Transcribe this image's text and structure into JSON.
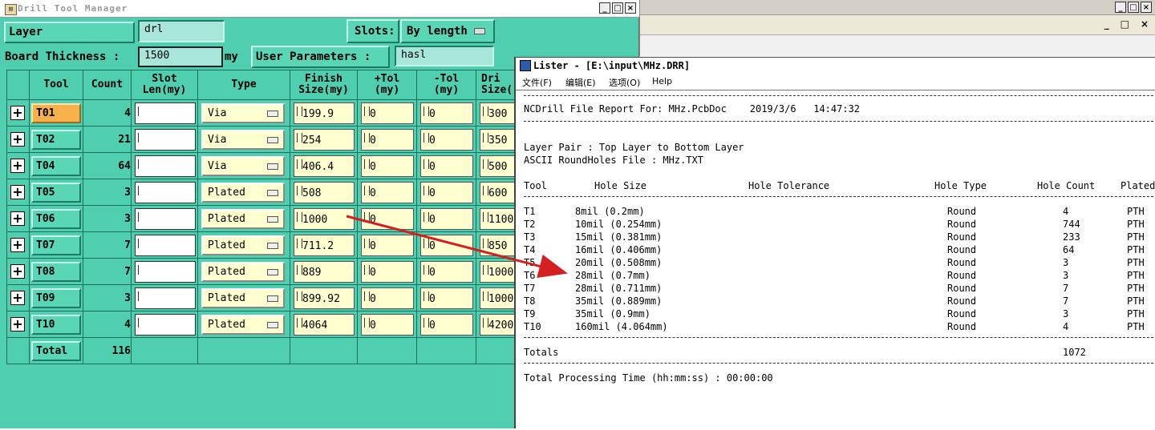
{
  "drill": {
    "title": "Drill Tool Manager",
    "window_buttons": [
      "_",
      "□",
      "×"
    ],
    "layer_label": "Layer                :",
    "layer_value": "drl",
    "slots_label": "Slots:",
    "slots_value": "By length",
    "thickness_label": "Board Thickness :",
    "thickness_value": "1500",
    "thickness_unit": "my",
    "user_params_label": "User Parameters :",
    "user_params_value": "hasl",
    "headers": {
      "tool": "Tool",
      "count": "Count",
      "slot1": "Slot",
      "slot2": "Len(my)",
      "type": "Type",
      "finish1": "Finish",
      "finish2": "Size(my)",
      "ptol1": "+Tol",
      "ptol2": "(my)",
      "mtol1": "-Tol",
      "mtol2": "(my)",
      "drill1": "Dri",
      "drill2": "Size("
    },
    "rows": [
      {
        "tool": "T01",
        "count": "4",
        "type": "Via",
        "finish": "199.9",
        "ptol": "0",
        "mtol": "0",
        "drill": "300"
      },
      {
        "tool": "T02",
        "count": "21",
        "type": "Via",
        "finish": "254",
        "ptol": "0",
        "mtol": "0",
        "drill": "350"
      },
      {
        "tool": "T04",
        "count": "64",
        "type": "Via",
        "finish": "406.4",
        "ptol": "0",
        "mtol": "0",
        "drill": "500"
      },
      {
        "tool": "T05",
        "count": "3",
        "type": "Plated",
        "finish": "508",
        "ptol": "0",
        "mtol": "0",
        "drill": "600"
      },
      {
        "tool": "T06",
        "count": "3",
        "type": "Plated",
        "finish": "1000",
        "ptol": "0",
        "mtol": "0",
        "drill": "1100"
      },
      {
        "tool": "T07",
        "count": "7",
        "type": "Plated",
        "finish": "711.2",
        "ptol": "0",
        "mtol": "0",
        "drill": "850"
      },
      {
        "tool": "T08",
        "count": "7",
        "type": "Plated",
        "finish": "889",
        "ptol": "0",
        "mtol": "0",
        "drill": "1000"
      },
      {
        "tool": "T09",
        "count": "3",
        "type": "Plated",
        "finish": "899.92",
        "ptol": "0",
        "mtol": "0",
        "drill": "1000"
      },
      {
        "tool": "T10",
        "count": "4",
        "type": "Plated",
        "finish": "4064",
        "ptol": "0",
        "mtol": "0",
        "drill": "4200"
      }
    ],
    "total_label": "Total",
    "total_count": "116",
    "selected_tool": "T01"
  },
  "lister": {
    "title": "Lister - [E:\\input\\MHz.DRR]",
    "menu": [
      "文件(F)",
      "编辑(E)",
      "选项(O)",
      "Help"
    ],
    "report_line": "NCDrill File Report For: MHz.PcbDoc    2019/3/6   14:47:32",
    "layer_pair": "Layer Pair : Top Layer to Bottom Layer",
    "ascii_file": "ASCII RoundHoles File : MHz.TXT",
    "cols": [
      "Tool",
      "Hole Size",
      "Hole Tolerance",
      "Hole Type",
      "Hole Count",
      "Plated"
    ],
    "rows": [
      {
        "tool": "T1",
        "size": "8mil (0.2mm)",
        "type": "Round",
        "count": "4",
        "plated": "PTH"
      },
      {
        "tool": "T2",
        "size": "10mil (0.254mm)",
        "type": "Round",
        "count": "744",
        "plated": "PTH"
      },
      {
        "tool": "T3",
        "size": "15mil (0.381mm)",
        "type": "Round",
        "count": "233",
        "plated": "PTH"
      },
      {
        "tool": "T4",
        "size": "16mil (0.406mm)",
        "type": "Round",
        "count": "64",
        "plated": "PTH"
      },
      {
        "tool": "T5",
        "size": "20mil (0.508mm)",
        "type": "Round",
        "count": "3",
        "plated": "PTH"
      },
      {
        "tool": "T6",
        "size": "28mil (0.7mm)",
        "type": "Round",
        "count": "3",
        "plated": "PTH"
      },
      {
        "tool": "T7",
        "size": "28mil (0.711mm)",
        "type": "Round",
        "count": "7",
        "plated": "PTH"
      },
      {
        "tool": "T8",
        "size": "35mil (0.889mm)",
        "type": "Round",
        "count": "7",
        "plated": "PTH"
      },
      {
        "tool": "T9",
        "size": "35mil (0.9mm)",
        "type": "Round",
        "count": "3",
        "plated": "PTH"
      },
      {
        "tool": "T10",
        "size": "160mil (4.064mm)",
        "type": "Round",
        "count": "4",
        "plated": "PTH"
      }
    ],
    "totals_label": "Totals",
    "totals_value": "1072",
    "processing": "Total Processing Time (hh:mm:ss) : 00:00:00"
  },
  "bg_window_buttons": [
    "_",
    "□",
    "×"
  ],
  "colors": {
    "teal": "#4fcfb0",
    "selected": "#f6b14a",
    "field_yellow": "#ffffd0",
    "arrow": "#d42020"
  }
}
